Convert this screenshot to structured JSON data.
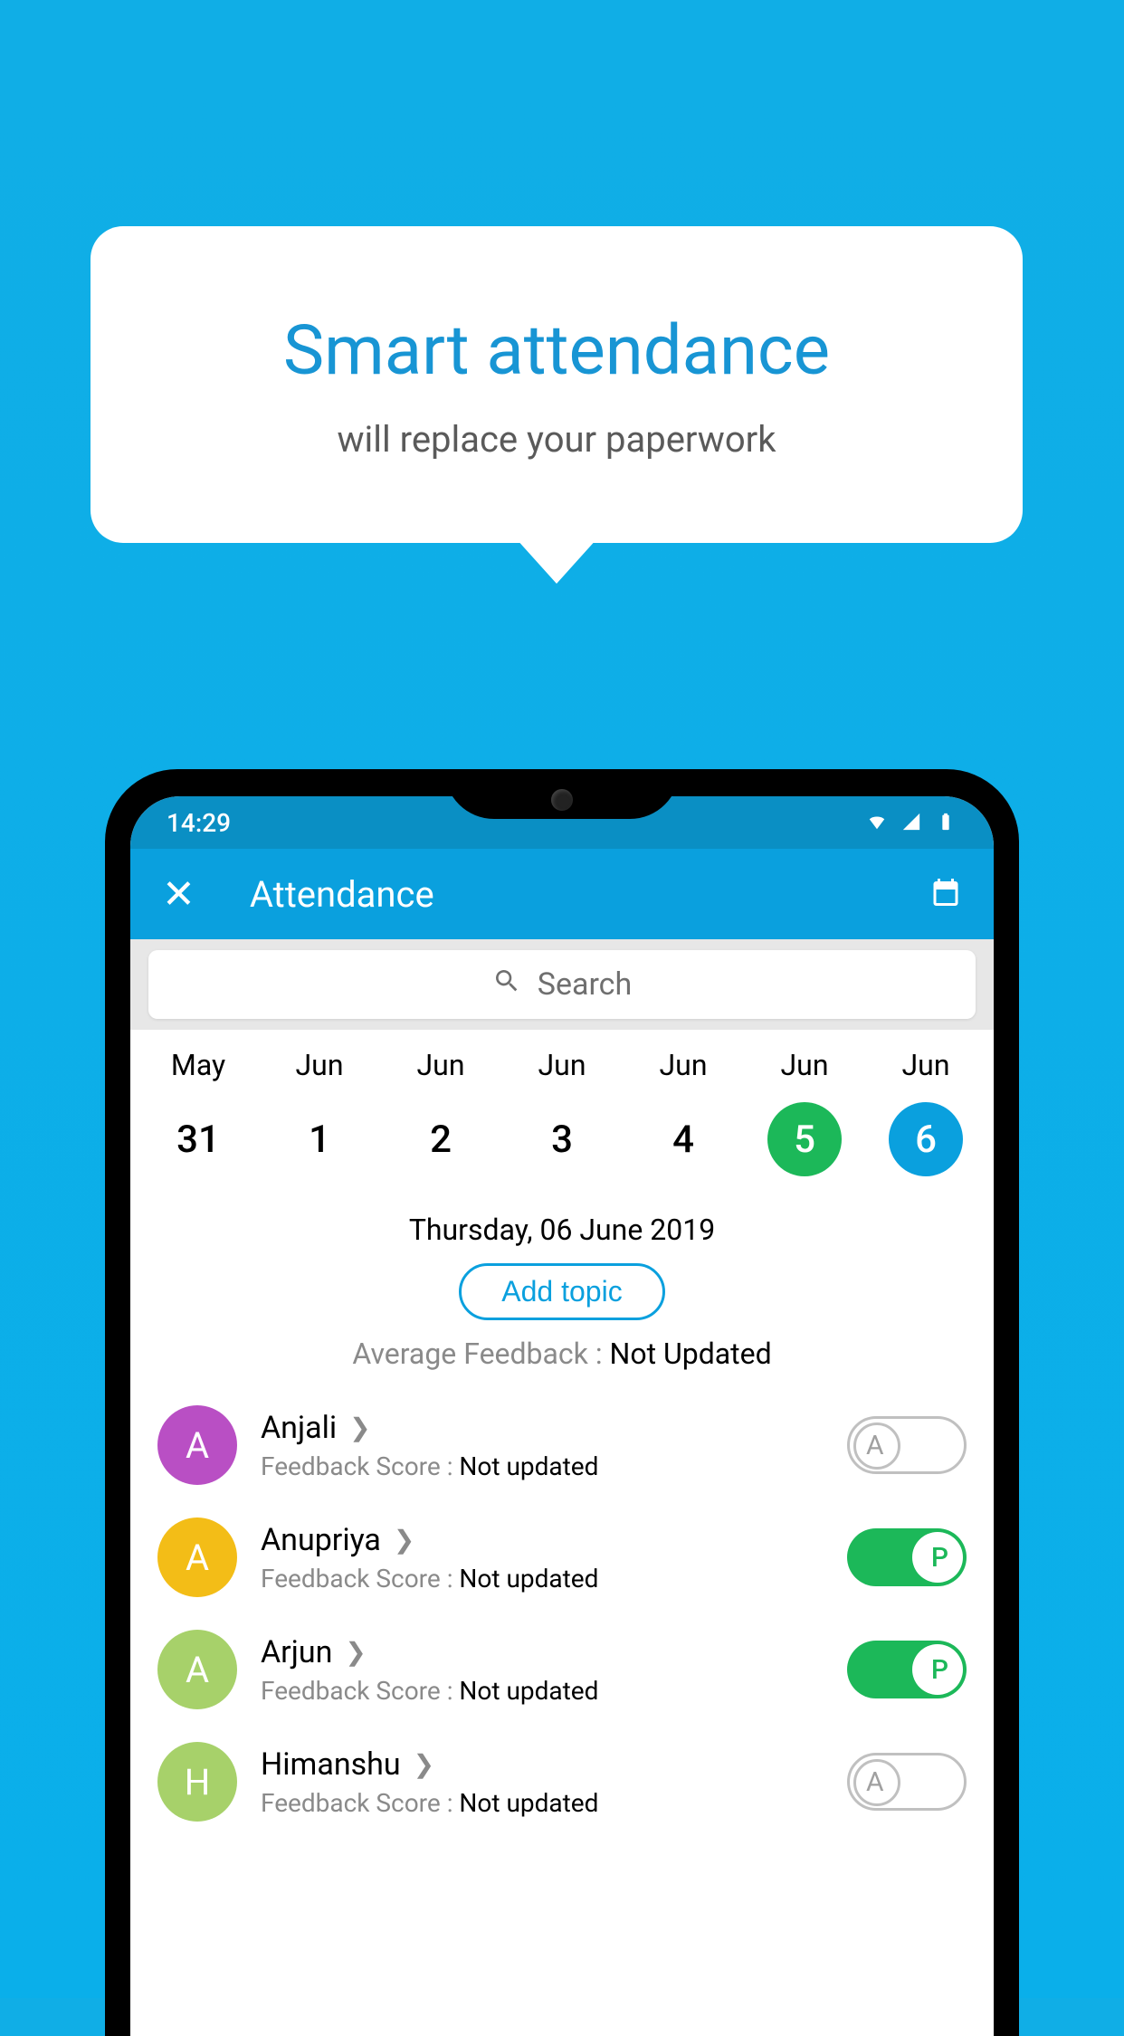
{
  "promo": {
    "title": "Smart attendance",
    "subtitle": "will replace your paperwork"
  },
  "statusbar": {
    "time": "14:29"
  },
  "appbar": {
    "title": "Attendance"
  },
  "search": {
    "placeholder": "Search"
  },
  "dates": [
    {
      "month": "May",
      "day": "31",
      "highlight": ""
    },
    {
      "month": "Jun",
      "day": "1",
      "highlight": ""
    },
    {
      "month": "Jun",
      "day": "2",
      "highlight": ""
    },
    {
      "month": "Jun",
      "day": "3",
      "highlight": ""
    },
    {
      "month": "Jun",
      "day": "4",
      "highlight": ""
    },
    {
      "month": "Jun",
      "day": "5",
      "highlight": "green"
    },
    {
      "month": "Jun",
      "day": "6",
      "highlight": "blue"
    }
  ],
  "fullDate": "Thursday, 06 June 2019",
  "addTopicLabel": "Add topic",
  "avgFeedback": {
    "label": "Average Feedback : ",
    "value": "Not Updated"
  },
  "students": [
    {
      "name": "Anjali",
      "initial": "A",
      "color": "#b94fc4",
      "fbLabel": "Feedback Score : ",
      "fbValue": "Not updated",
      "state": "A"
    },
    {
      "name": "Anupriya",
      "initial": "A",
      "color": "#f3bd17",
      "fbLabel": "Feedback Score : ",
      "fbValue": "Not updated",
      "state": "P"
    },
    {
      "name": "Arjun",
      "initial": "A",
      "color": "#a7d16a",
      "fbLabel": "Feedback Score : ",
      "fbValue": "Not updated",
      "state": "P"
    },
    {
      "name": "Himanshu",
      "initial": "H",
      "color": "#a7d16a",
      "fbLabel": "Feedback Score : ",
      "fbValue": "Not updated",
      "state": "A"
    }
  ]
}
